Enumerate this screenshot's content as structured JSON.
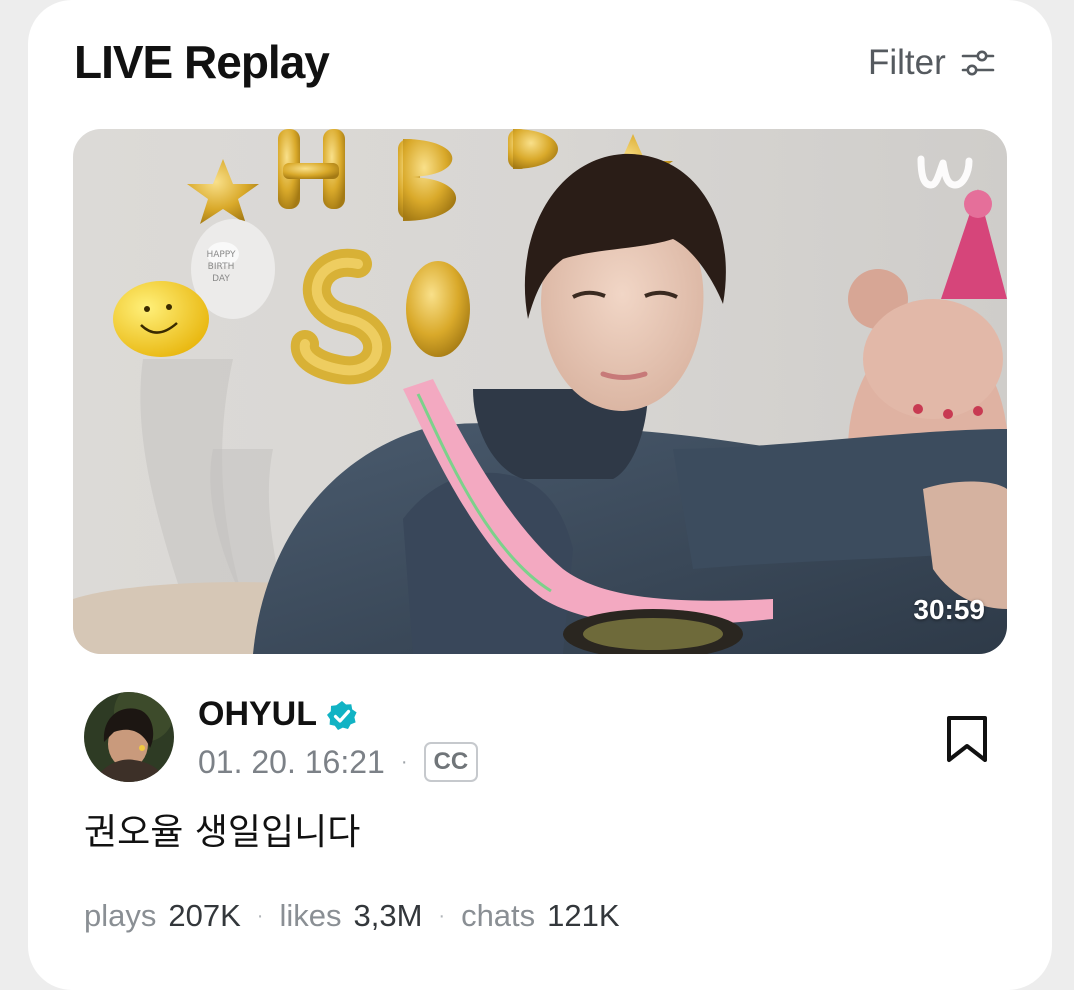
{
  "section": {
    "title": "LIVE Replay",
    "filter_label": "Filter"
  },
  "video": {
    "duration": "30:59",
    "channel": "OHYUL",
    "date": "01. 20. 16:21",
    "date_separator": "·",
    "cc_label": "CC",
    "title": "권오율 생일입니다",
    "stats": {
      "plays_label": "plays",
      "plays_value": "207K",
      "likes_label": "likes",
      "likes_value": "3,3M",
      "chats_label": "chats",
      "chats_value": "121K",
      "separator": "·"
    }
  },
  "icons": {
    "filter": "sliders-icon",
    "verified": "verified-badge-icon",
    "bookmark": "bookmark-icon",
    "logo": "weverse-logo-icon"
  },
  "colors": {
    "verified": "#11b3c4",
    "title": "#111111",
    "meta": "#7c8187"
  }
}
